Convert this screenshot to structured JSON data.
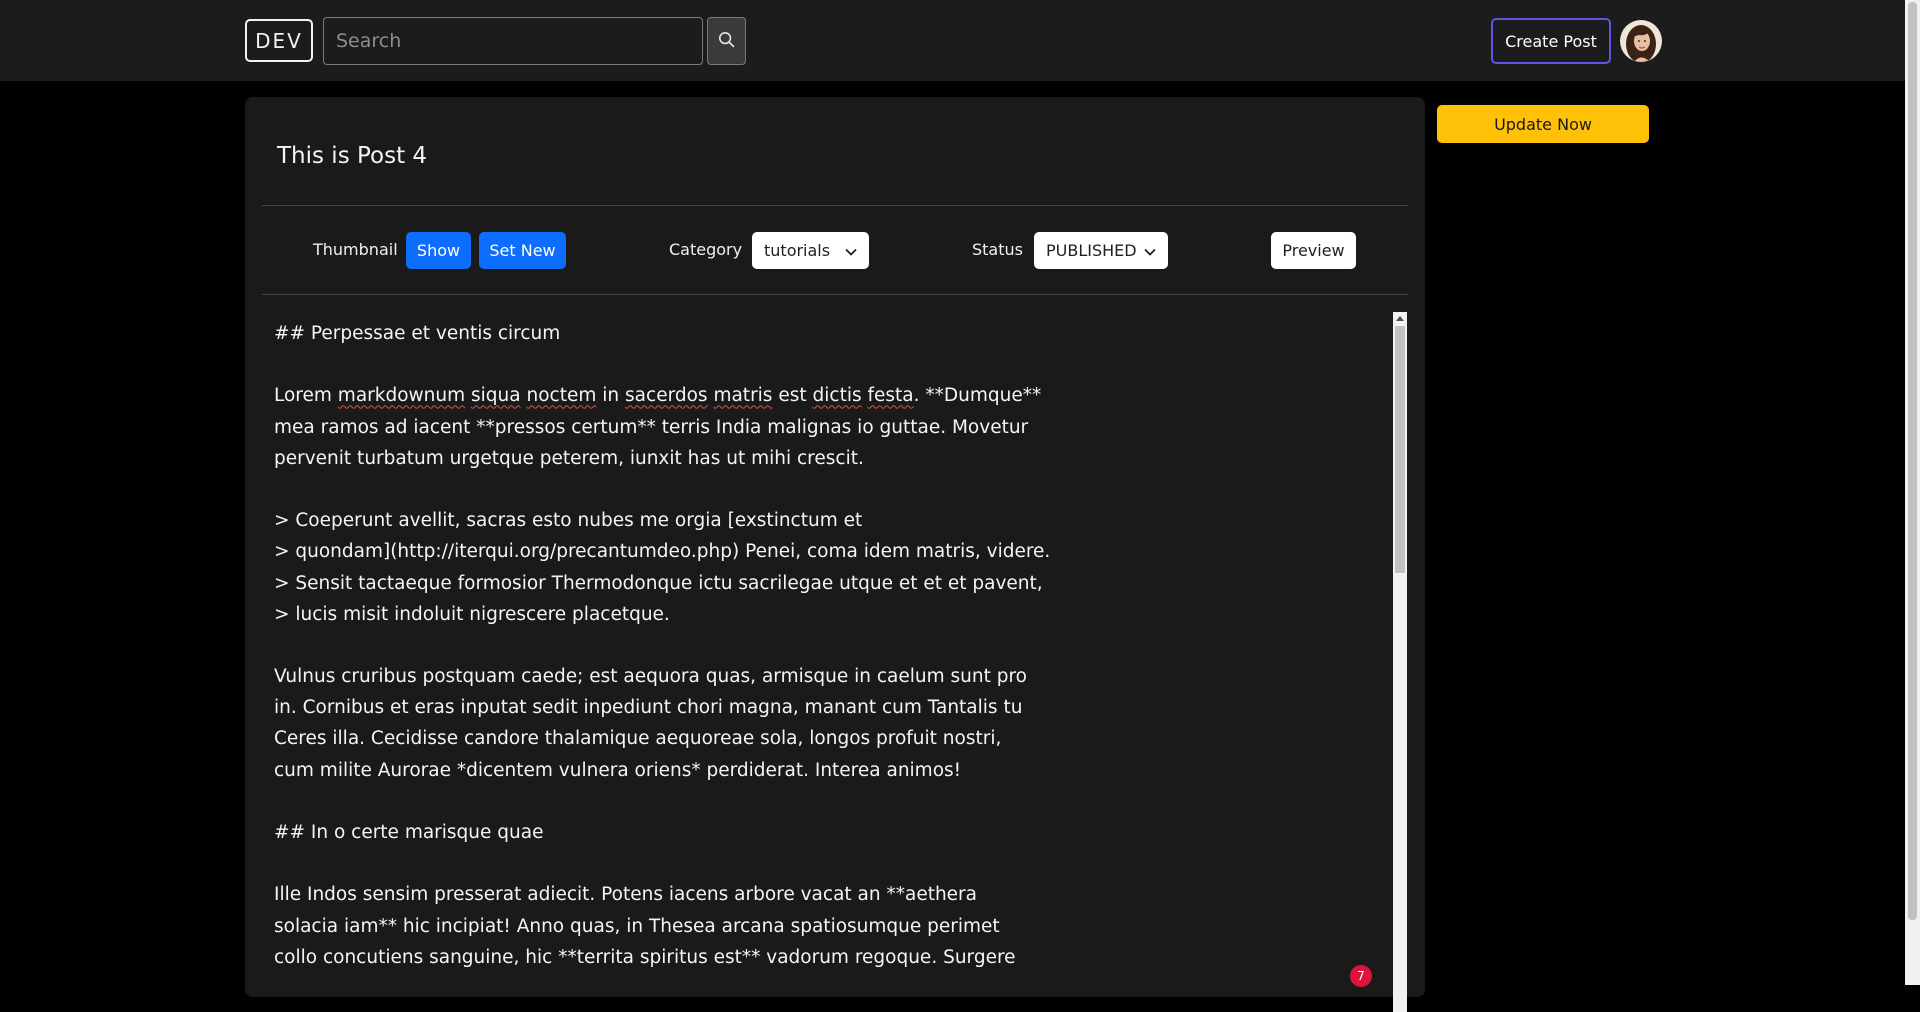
{
  "navbar": {
    "logo": "DEV",
    "search": {
      "placeholder": "Search",
      "value": ""
    },
    "search_icon": "search-icon",
    "create_post_label": "Create Post",
    "avatar_icon": "user-avatar"
  },
  "editor": {
    "title": "This is Post 4",
    "thumbnail_label": "Thumbnail",
    "show_label": "Show",
    "set_new_label": "Set New",
    "category_label": "Category",
    "category_value": "tutorials",
    "status_label": "Status",
    "status_value": "PUBLISHED",
    "preview_label": "Preview",
    "notification_count": "7",
    "lines": [
      "## Perpessae et ventis circum",
      "",
      "Lorem markdownum siqua noctem in sacerdos matris est dictis festa. **Dumque**",
      "mea ramos ad iacent **pressos certum** terris India malignas io guttae. Movetur",
      "pervenit turbatum urgetque peterem, iunxit has ut mihi crescit.",
      "",
      "> Coeperunt avellit, sacras esto nubes me orgia [exstinctum et",
      "> quondam](http://iterqui.org/precantumdeo.php) Penei, coma idem matris, videre.",
      "> Sensit tactaeque formosior Thermodonque ictu sacrilegae utque et et et pavent,",
      "> lucis misit indoluit nigrescere placetque.",
      "",
      "Vulnus cruribus postquam caede; est aequora quas, armisque in caelum sunt pro",
      "in. Cornibus et eras inputat sedit inpediunt chori magna, manant cum Tantalis tu",
      "Ceres illa. Cecidisse candore thalamique aequoreae sola, longos profuit nostri,",
      "cum milite Aurorae *dicentem vulnera oriens* perdiderat. Interea animos!",
      "",
      "## In o certe marisque quae",
      "",
      "Ille Indos sensim presserat adiecit. Potens iacens arbore vacat an **aethera",
      "solacia iam** hic incipiat! Anno quas, in Thesea arcana spatiosumque perimet",
      "collo concutiens sanguine, hic **territa spiritus est** vadorum regoque. Surgere"
    ]
  },
  "sidebar": {
    "update_label": "Update Now"
  },
  "colors": {
    "navbar_bg": "#1c1c1c",
    "page_bg": "#000000",
    "card_bg": "#1a1a1a",
    "primary": "#0d6efd",
    "warning": "#ffc107",
    "create_post_border": "#5b55e0",
    "badge": "#dc143c"
  }
}
